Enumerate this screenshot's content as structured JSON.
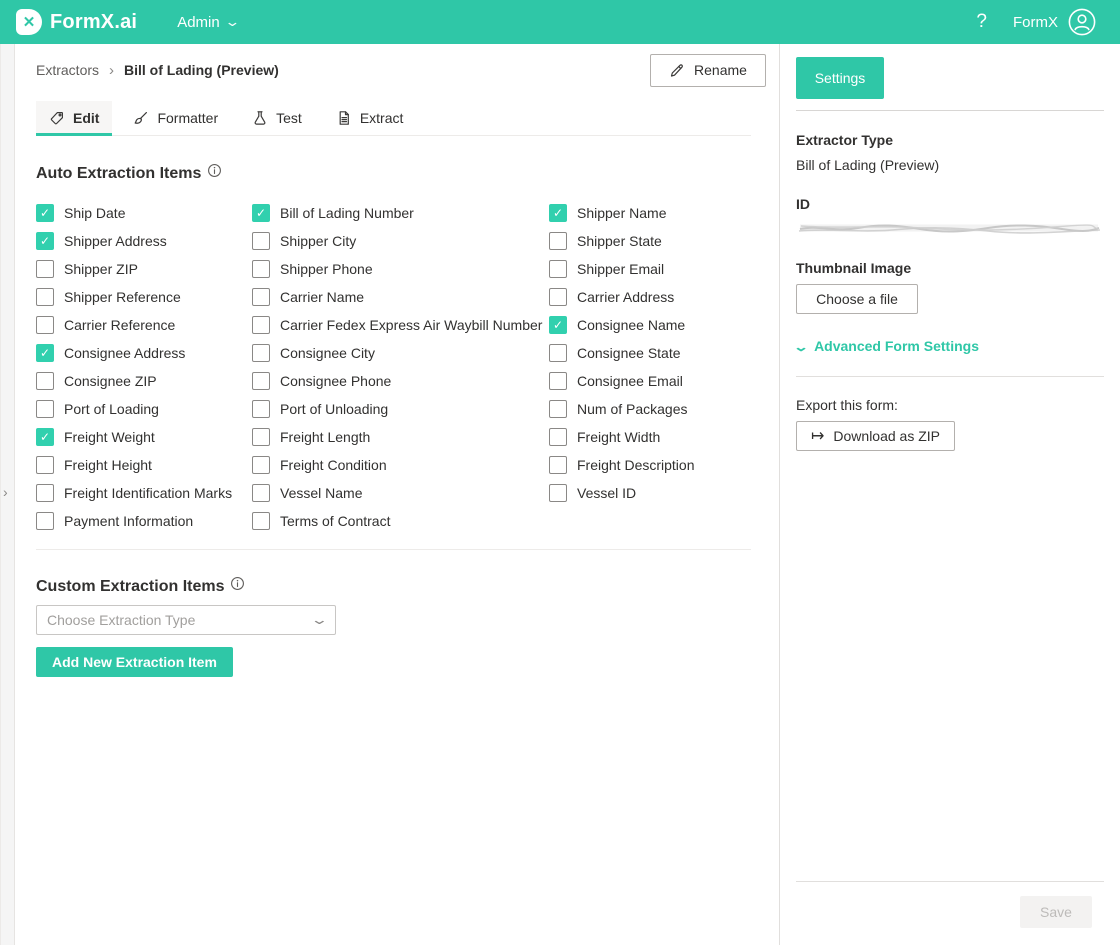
{
  "header": {
    "logo_text": "FormX.ai",
    "admin_label": "Admin",
    "help_icon": "?",
    "account_label": "FormX"
  },
  "breadcrumb": {
    "items": [
      "Extractors",
      "Bill of Lading (Preview)"
    ]
  },
  "toolbar": {
    "rename_label": "Rename"
  },
  "tabs": [
    {
      "label": "Edit",
      "icon": "tag-icon",
      "active": true
    },
    {
      "label": "Formatter",
      "icon": "brush-icon",
      "active": false
    },
    {
      "label": "Test",
      "icon": "flask-icon",
      "active": false
    },
    {
      "label": "Extract",
      "icon": "document-icon",
      "active": false
    }
  ],
  "auto_extraction": {
    "title": "Auto Extraction Items",
    "columns": [
      {
        "items": [
          {
            "label": "Ship Date",
            "checked": true
          },
          {
            "label": "Shipper Address",
            "checked": true
          },
          {
            "label": "Shipper ZIP",
            "checked": false
          },
          {
            "label": "Shipper Reference",
            "checked": false
          },
          {
            "label": "Carrier Reference",
            "checked": false
          },
          {
            "label": "Consignee Address",
            "checked": true
          },
          {
            "label": "Consignee ZIP",
            "checked": false
          },
          {
            "label": "Port of Loading",
            "checked": false
          },
          {
            "label": "Freight Weight",
            "checked": true
          },
          {
            "label": "Freight Height",
            "checked": false
          },
          {
            "label": "Freight Identification Marks",
            "checked": false
          },
          {
            "label": "Payment Information",
            "checked": false
          }
        ]
      },
      {
        "items": [
          {
            "label": "Bill of Lading Number",
            "checked": true
          },
          {
            "label": "Shipper City",
            "checked": false
          },
          {
            "label": "Shipper Phone",
            "checked": false
          },
          {
            "label": "Carrier Name",
            "checked": false
          },
          {
            "label": "Carrier Fedex Express Air Waybill Number",
            "checked": false
          },
          {
            "label": "Consignee City",
            "checked": false
          },
          {
            "label": "Consignee Phone",
            "checked": false
          },
          {
            "label": "Port of Unloading",
            "checked": false
          },
          {
            "label": "Freight Length",
            "checked": false
          },
          {
            "label": "Freight Condition",
            "checked": false
          },
          {
            "label": "Vessel Name",
            "checked": false
          },
          {
            "label": "Terms of Contract",
            "checked": false
          }
        ]
      },
      {
        "items": [
          {
            "label": "Shipper Name",
            "checked": true
          },
          {
            "label": "Shipper State",
            "checked": false
          },
          {
            "label": "Shipper Email",
            "checked": false
          },
          {
            "label": "Carrier Address",
            "checked": false
          },
          {
            "label": "Consignee Name",
            "checked": true
          },
          {
            "label": "Consignee State",
            "checked": false
          },
          {
            "label": "Consignee Email",
            "checked": false
          },
          {
            "label": "Num of Packages",
            "checked": false
          },
          {
            "label": "Freight Width",
            "checked": false
          },
          {
            "label": "Freight Description",
            "checked": false
          },
          {
            "label": "Vessel ID",
            "checked": false
          }
        ]
      }
    ]
  },
  "custom_extraction": {
    "title": "Custom Extraction Items",
    "dropdown_placeholder": "Choose Extraction Type",
    "add_button_label": "Add New Extraction Item"
  },
  "settings_panel": {
    "settings_button_label": "Settings",
    "extractor_type_label": "Extractor Type",
    "extractor_type_value": "Bill of Lading (Preview)",
    "id_label": "ID",
    "id_value_redacted": true,
    "thumbnail_label": "Thumbnail Image",
    "choose_file_label": "Choose a file",
    "advanced_link_label": "Advanced Form Settings",
    "export_label": "Export this form:",
    "download_label": "Download as ZIP",
    "save_label": "Save"
  },
  "icons": {
    "check": "✓",
    "chevron_down": "⌄",
    "breadcrumb_separator": "›",
    "expand_chevron": "›",
    "download_arrow": "↦",
    "logo_x": "✕"
  },
  "colors": {
    "accent_teal": "#2FC7A7",
    "checkbox_checked": "#31D0AE",
    "text_primary": "#323130",
    "text_secondary": "#605E5C",
    "placeholder": "#A19F9D",
    "divider": "#EDEBE9",
    "disabled_bg": "#F3F2F1"
  }
}
